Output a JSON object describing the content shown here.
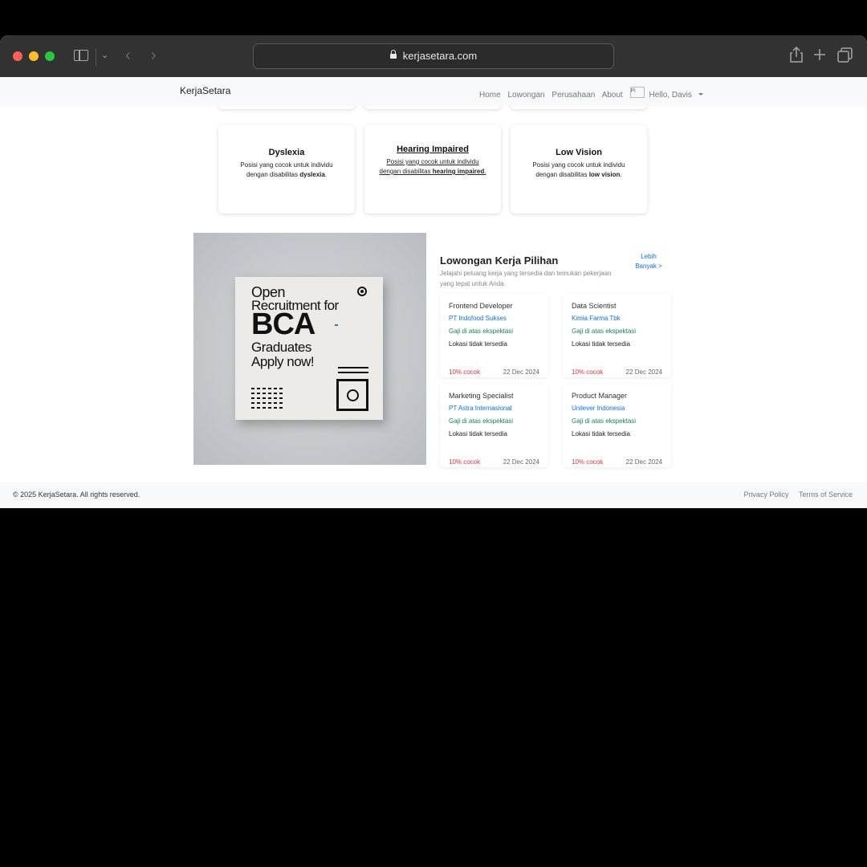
{
  "browser": {
    "url": "kerjasetara.com"
  },
  "navbar": {
    "brand": "KerjaSetara",
    "links": [
      "Home",
      "Lowongan",
      "Perusahaan",
      "About"
    ],
    "avatar_alt": "Pi",
    "user_greeting": "Hello, Davis"
  },
  "disability_cards": [
    {
      "title": "Dyslexia",
      "desc_prefix": "Posisi yang cocok untuk individu dengan disabilitas ",
      "desc_bold": "dyslexia",
      "desc_suffix": "."
    },
    {
      "title": "Hearing Impaired",
      "desc_prefix": "Posisi yang cocok untuk individu dengan disabilitas ",
      "desc_bold": "hearing impaired",
      "desc_suffix": "."
    },
    {
      "title": "Low Vision",
      "desc_prefix": "Posisi yang cocok untuk individu dengan disabilitas ",
      "desc_bold": "low vision",
      "desc_suffix": "."
    }
  ],
  "banner": {
    "line1": "Open",
    "line2": "Recruitment for",
    "line3": "BCA",
    "line4": "Graduates",
    "line5": "Apply now!"
  },
  "featured": {
    "title": "Lowongan Kerja Pilihan",
    "subtitle": "Jelajahi peluang kerja yang tersedia dan temukan pekerjaan yang tepat untuk Anda.",
    "more_label": "Lebih Banyak >",
    "jobs": [
      {
        "title": "Frontend Developer",
        "company": "PT Indofood Sukses",
        "salary": "Gaji di atas ekspektasi",
        "location": "Lokasi tidak tersedia",
        "match": "10% cocok",
        "date": "22 Dec 2024"
      },
      {
        "title": "Data Scientist",
        "company": "Kimia Farma Tbk",
        "salary": "Gaji di atas ekspektasi",
        "location": "Lokasi tidak tersedia",
        "match": "10% cocok",
        "date": "22 Dec 2024"
      },
      {
        "title": "Marketing Specialist",
        "company": "PT Astra Internasional",
        "salary": "Gaji di atas ekspektasi",
        "location": "Lokasi tidak tersedia",
        "match": "10% cocok",
        "date": "22 Dec 2024"
      },
      {
        "title": "Product Manager",
        "company": "Unilever Indonesia",
        "salary": "Gaji di atas ekspektasi",
        "location": "Lokasi tidak tersedia",
        "match": "10% cocok",
        "date": "22 Dec 2024"
      }
    ]
  },
  "footer": {
    "copyright": "© 2025 KerjaSetara. All rights reserved.",
    "privacy": "Privacy Policy",
    "terms": "Terms of Service"
  }
}
